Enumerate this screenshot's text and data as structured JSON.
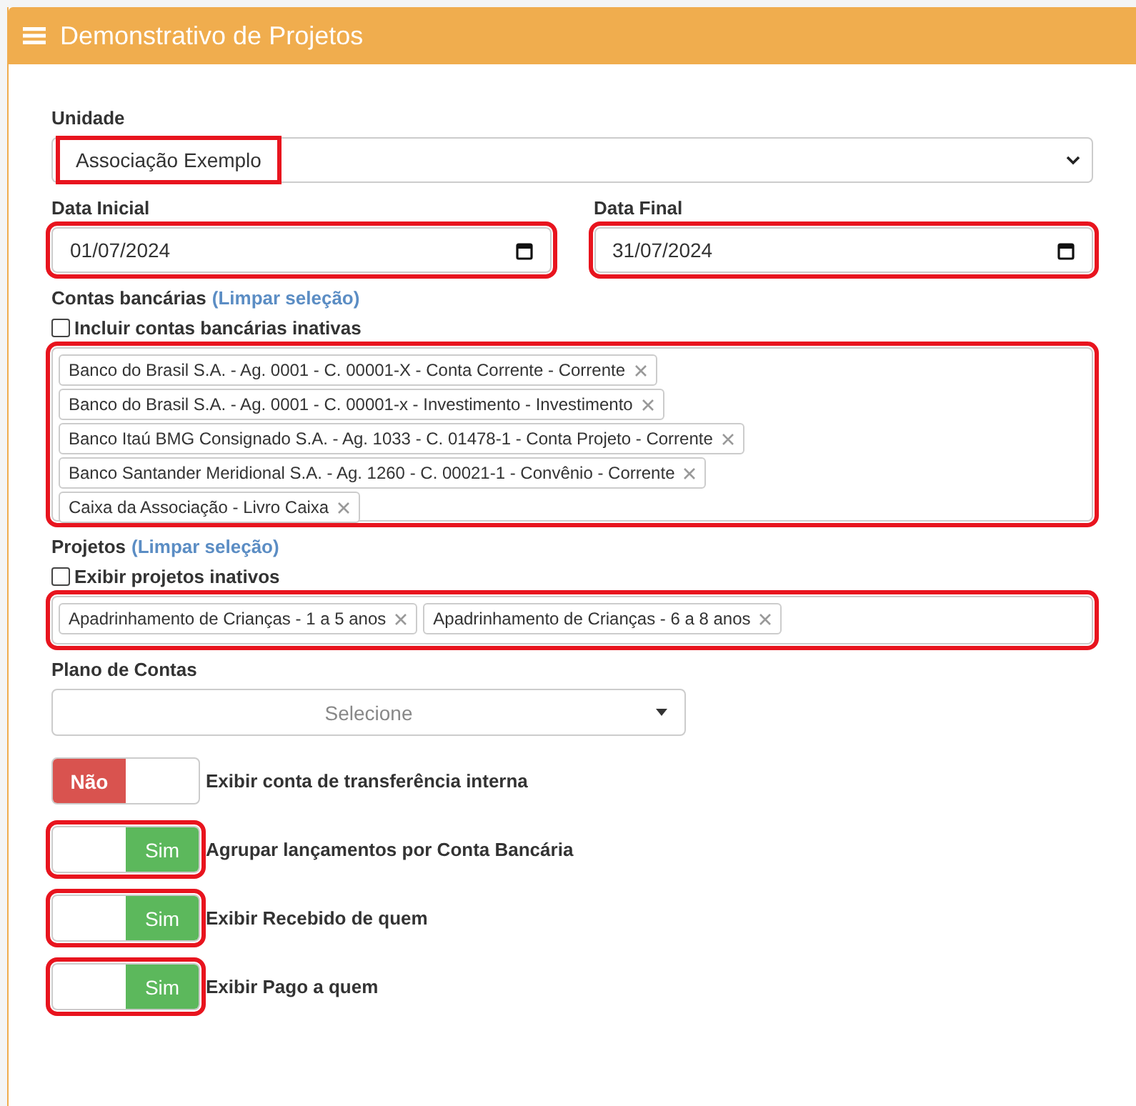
{
  "panel": {
    "title": "Demonstrativo de Projetos"
  },
  "unidade": {
    "label": "Unidade",
    "value": "Associação Exemplo",
    "highlighted": true
  },
  "dates": [
    {
      "label": "Data Inicial",
      "value": "01/07/2024",
      "highlighted": true
    },
    {
      "label": "Data Final",
      "value": "31/07/2024",
      "highlighted": true
    }
  ],
  "contas": {
    "label": "Contas bancárias",
    "clear_link": "(Limpar seleção)",
    "checkbox": {
      "label": "Incluir contas bancárias inativas",
      "checked": false
    },
    "highlighted": true,
    "tags": [
      "Banco do Brasil S.A. - Ag. 0001 - C. 00001-X - Conta Corrente - Corrente",
      "Banco do Brasil S.A. - Ag. 0001 - C. 00001-x - Investimento - Investimento",
      "Banco Itaú BMG Consignado S.A. - Ag. 1033 - C. 01478-1 - Conta Projeto - Corrente",
      "Banco Santander Meridional S.A. - Ag. 1260 - C. 00021-1 - Convênio - Corrente",
      "Caixa da Associação - Livro Caixa"
    ]
  },
  "projetos": {
    "label": "Projetos",
    "clear_link": "(Limpar seleção)",
    "checkbox": {
      "label": "Exibir projetos inativos",
      "checked": false
    },
    "highlighted": true,
    "tags": [
      "Apadrinhamento de Crianças - 1 a 5 anos",
      "Apadrinhamento de Crianças - 6 a 8 anos"
    ]
  },
  "plano": {
    "label": "Plano de Contas",
    "placeholder": "Selecione"
  },
  "toggles": [
    {
      "label": "Exibir conta de transferência interna",
      "on": false,
      "text": "Não",
      "highlighted": false
    },
    {
      "label": "Agrupar lançamentos por Conta Bancária",
      "on": true,
      "text": "Sim",
      "highlighted": true
    },
    {
      "label": "Exibir Recebido de quem",
      "on": true,
      "text": "Sim",
      "highlighted": true
    },
    {
      "label": "Exibir Pago a quem",
      "on": true,
      "text": "Sim",
      "highlighted": true
    }
  ]
}
